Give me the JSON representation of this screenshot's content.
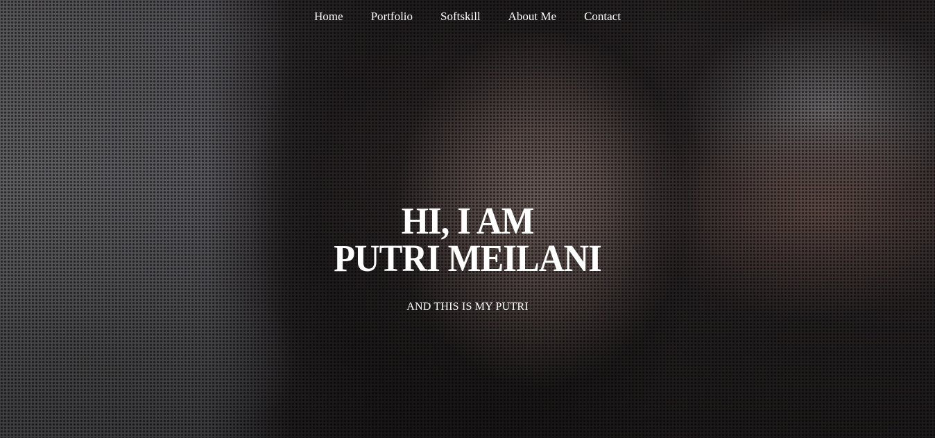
{
  "nav": {
    "items": [
      {
        "label": "Home"
      },
      {
        "label": "Portfolio"
      },
      {
        "label": "Softskill"
      },
      {
        "label": "About Me"
      },
      {
        "label": "Contact"
      }
    ]
  },
  "hero": {
    "title_line1": "HI, I AM",
    "title_line2": "PUTRI MEILANI",
    "subtitle": "AND THIS IS MY PUTRI"
  }
}
